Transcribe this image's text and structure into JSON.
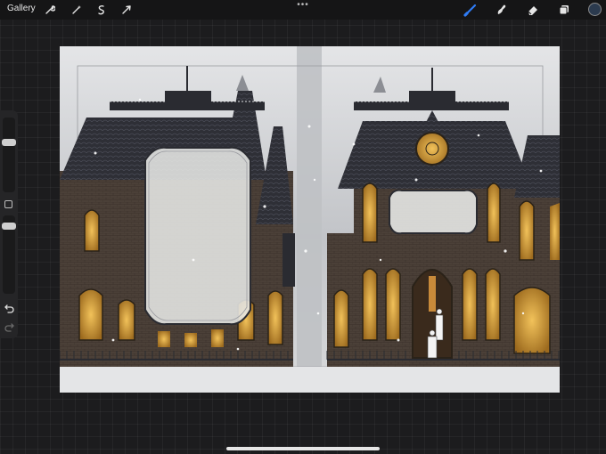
{
  "toolbar": {
    "gallery_label": "Gallery",
    "left_tools": [
      "wrench-icon",
      "magic-wand-icon",
      "selection-icon",
      "transform-icon"
    ],
    "right_tools": [
      "brush-icon",
      "smudge-icon",
      "eraser-icon",
      "layers-icon"
    ],
    "more_label": "•••",
    "active_tool": "brush",
    "accent_color": "#2f7cf6",
    "current_color": "#2b3a4e"
  },
  "sidebar": {
    "icons": [
      "brush-size-slider",
      "modify-button-icon",
      "opacity-slider",
      "undo-icon",
      "redo-icon"
    ]
  },
  "colors": {
    "background": "#1c1c1e",
    "topbar": "#151516",
    "sidebar": "#252527"
  }
}
